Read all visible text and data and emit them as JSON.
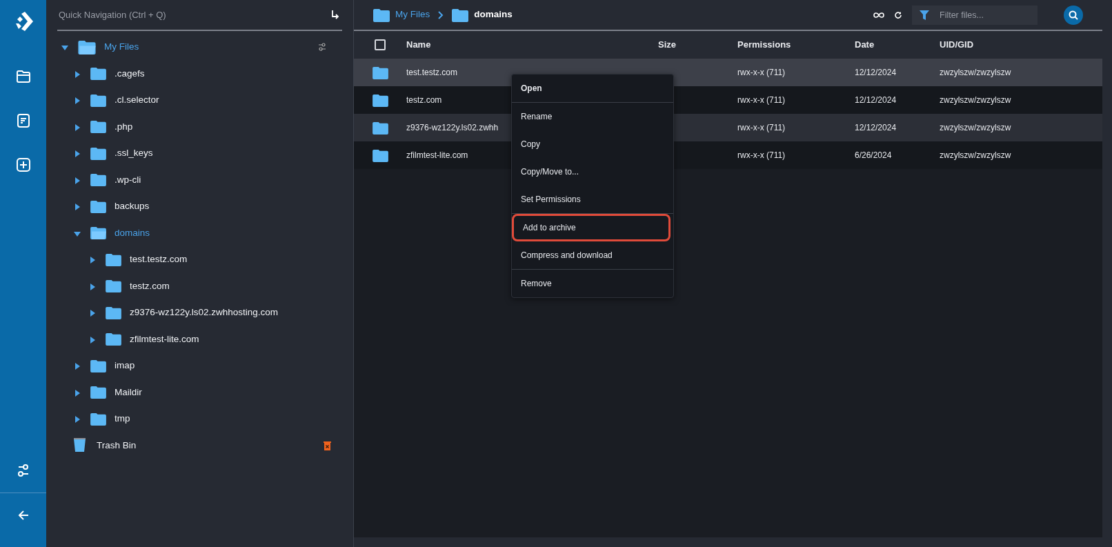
{
  "quick_navigation": {
    "placeholder": "Quick Navigation (Ctrl + Q)"
  },
  "tree": {
    "label": "My Files",
    "expanded": true,
    "active": true,
    "children": [
      {
        "label": ".cagefs",
        "expanded": false,
        "active": false
      },
      {
        "label": ".cl.selector",
        "expanded": false,
        "active": false
      },
      {
        "label": ".php",
        "expanded": false,
        "active": false
      },
      {
        "label": ".ssl_keys",
        "expanded": false,
        "active": false
      },
      {
        "label": ".wp-cli",
        "expanded": false,
        "active": false
      },
      {
        "label": "backups",
        "expanded": false,
        "active": false
      },
      {
        "label": "domains",
        "expanded": true,
        "active": true,
        "children": [
          {
            "label": "test.testz.com",
            "expanded": false,
            "active": false
          },
          {
            "label": "testz.com",
            "expanded": false,
            "active": false
          },
          {
            "label": "z9376-wz122y.ls02.zwhhosting.com",
            "expanded": false,
            "active": false
          },
          {
            "label": "zfilmtest-lite.com",
            "expanded": false,
            "active": false
          }
        ]
      },
      {
        "label": "imap",
        "expanded": false,
        "active": false
      },
      {
        "label": "Maildir",
        "expanded": false,
        "active": false
      },
      {
        "label": "tmp",
        "expanded": false,
        "active": false
      }
    ]
  },
  "trash": {
    "label": "Trash Bin"
  },
  "breadcrumb": [
    {
      "label": "My Files",
      "current": false
    },
    {
      "label": "domains",
      "current": true
    }
  ],
  "filter": {
    "placeholder": "Filter files..."
  },
  "select_all": {
    "checked": false
  },
  "table": {
    "columns": [
      "Name",
      "Size",
      "Permissions",
      "Date",
      "UID/GID"
    ],
    "rows": [
      {
        "name": "test.testz.com",
        "permissions": "rwx-x-x (711)",
        "date": "12/12/2024",
        "owner": "zwzylszw/zwzylszw",
        "selected": true
      },
      {
        "name": "testz.com",
        "permissions": "rwx-x-x (711)",
        "date": "12/12/2024",
        "owner": "zwzylszw/zwzylszw",
        "selected": false
      },
      {
        "name": "z9376-wz122y.ls02.zwhh",
        "permissions": "rwx-x-x (711)",
        "date": "12/12/2024",
        "owner": "zwzylszw/zwzylszw",
        "selected": false
      },
      {
        "name": "zfilmtest-lite.com",
        "permissions": "rwx-x-x (711)",
        "date": "6/26/2024",
        "owner": "zwzylszw/zwzylszw",
        "selected": false
      }
    ]
  },
  "context_menu": [
    {
      "label": "Open",
      "bold": true,
      "separator_after": true,
      "highlighted": false
    },
    {
      "label": "Rename",
      "bold": false,
      "separator_after": false,
      "highlighted": false
    },
    {
      "label": "Copy",
      "bold": false,
      "separator_after": false,
      "highlighted": false
    },
    {
      "label": "Copy/Move to...",
      "bold": false,
      "separator_after": false,
      "highlighted": false
    },
    {
      "label": "Set Permissions",
      "bold": false,
      "separator_after": true,
      "highlighted": false
    },
    {
      "label": "Add to archive",
      "bold": false,
      "separator_after": false,
      "highlighted": true
    },
    {
      "label": "Compress and download",
      "bold": false,
      "separator_after": true,
      "highlighted": false
    },
    {
      "label": "Remove",
      "bold": false,
      "separator_after": false,
      "highlighted": false
    }
  ]
}
